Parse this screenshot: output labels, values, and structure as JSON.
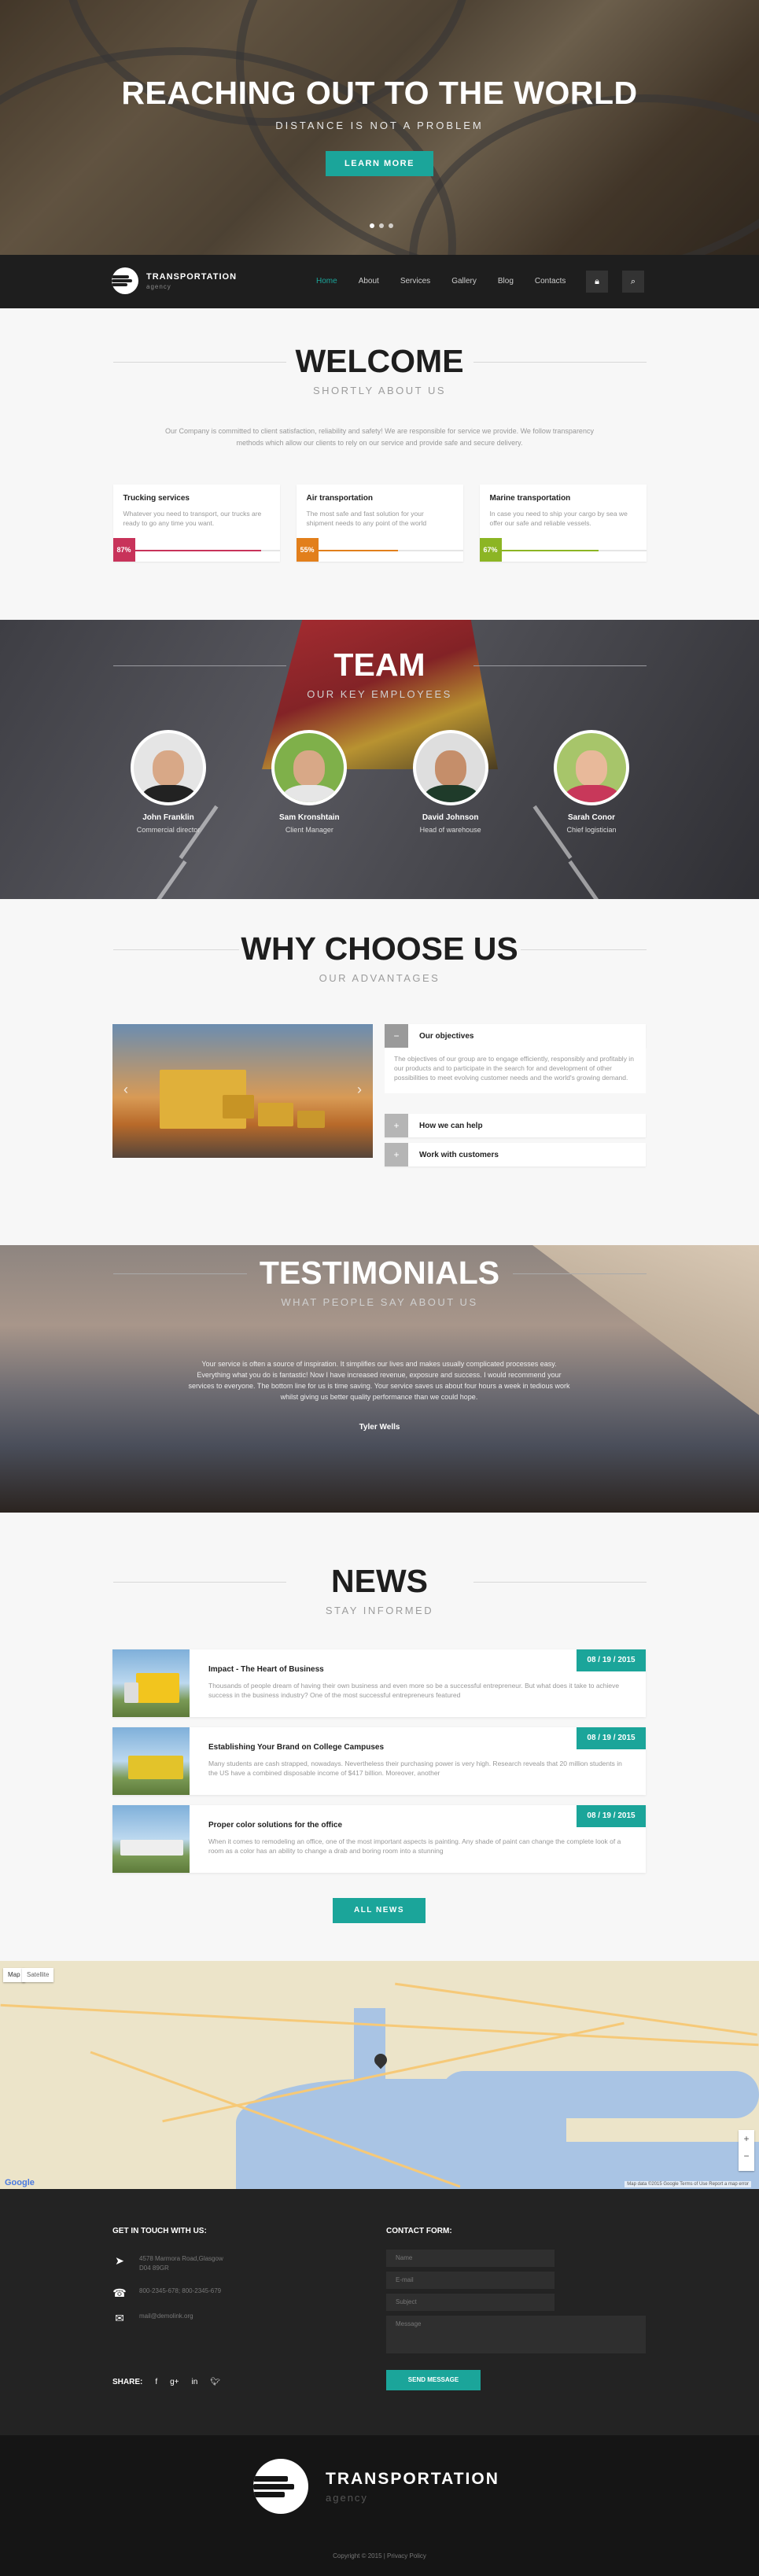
{
  "hero": {
    "title": "REACHING OUT TO THE WORLD",
    "subtitle": "DISTANCE IS NOT A PROBLEM",
    "button": "LEARN MORE"
  },
  "nav": {
    "logo_title": "TRANSPORTATION",
    "logo_sub": "agency",
    "items": [
      "Home",
      "About",
      "Services",
      "Gallery",
      "Blog",
      "Contacts"
    ],
    "active": "Home",
    "lock_icon": "lock-icon",
    "search_icon": "search-icon"
  },
  "welcome": {
    "title": "WELCOME",
    "subtitle": "SHORTLY ABOUT US",
    "intro": "Our Company is committed to client satisfaction, reliability and safety! We are responsible for service we provide. We follow transparency methods which allow our clients to rely on our service and provide safe and secure delivery.",
    "cards": [
      {
        "title": "Trucking services",
        "text": "Whatever you need to transport, our trucks are ready to go any time you want.",
        "percent": "87%",
        "value": 0.87,
        "color": "#c8335a"
      },
      {
        "title": "Air transportation",
        "text": "The most safe and fast solution for your shipment needs to any point of the world",
        "percent": "55%",
        "value": 0.55,
        "color": "#e27f1b"
      },
      {
        "title": "Marine transportation",
        "text": "In case you need to ship your cargo by sea we offer our safe and reliable vessels.",
        "percent": "67%",
        "value": 0.67,
        "color": "#8cb524"
      }
    ]
  },
  "team": {
    "title": "TEAM",
    "subtitle": "OUR KEY EMPLOYEES",
    "members": [
      {
        "name": "John Franklin",
        "role": "Commercial director"
      },
      {
        "name": "Sam Kronshtain",
        "role": "Client Manager"
      },
      {
        "name": "David Johnson",
        "role": "Head of warehouse"
      },
      {
        "name": "Sarah Conor",
        "role": "Chief logistician"
      }
    ]
  },
  "why": {
    "title": "WHY CHOOSE US",
    "subtitle": "OUR ADVANTAGES",
    "items": [
      {
        "title": "Our objectives",
        "text": "The objectives of our group are to engage efficiently, responsibly and profitably in our products and to participate in the search for and development of other possibilities to meet evolving customer needs and the world's growing demand."
      },
      {
        "title": "How we can help"
      },
      {
        "title": "Work with customers"
      }
    ]
  },
  "testimonials": {
    "title": "TESTIMONIALS",
    "subtitle": "WHAT PEOPLE SAY ABOUT US",
    "quote": "Your service is often a source of inspiration. It simplifies our lives and makes usually complicated processes easy. Everything what you do is fantastic! Now I have increased revenue, exposure and success. I would recommend your services to everyone. The bottom line for us is time saving. Your service saves us about four hours a week in tedious work whilst giving us better quality performance than we could hope.",
    "author": "Tyler Wells"
  },
  "news": {
    "title": "NEWS",
    "subtitle": "STAY INFORMED",
    "items": [
      {
        "date": "08 / 19 / 2015",
        "title": "Impact - The Heart of Business",
        "text": "Thousands of people dream of having their own business and even more so be a successful entrepreneur. But what does it take to achieve success in the business industry? One of the most successful entrepreneurs featured"
      },
      {
        "date": "08 / 19 / 2015",
        "title": "Establishing Your Brand on College Campuses",
        "text": "Many students are cash strapped, nowadays. Nevertheless their purchasing power is very high. Research reveals that 20 million students in the US have a combined disposable income of $417 billion. Moreover, another"
      },
      {
        "date": "08 / 19 / 2015",
        "title": "Proper color solutions for the office",
        "text": "When it comes to remodeling an office, one of the most important aspects is painting. Any shade of paint can change the complete look of a room as a color has an ability to change a drab and boring room into a stunning"
      }
    ],
    "button": "ALL NEWS"
  },
  "map": {
    "tab_map": "Map",
    "tab_sat": "Satellite",
    "google": "Google",
    "copyright": "Map data ©2015 Google  Terms of Use  Report a map error",
    "zoom_in": "+",
    "zoom_out": "−"
  },
  "contact": {
    "heading": "GET IN TOUCH WITH US:",
    "address": "4578 Marmora Road,Glasgow D04 89GR",
    "phone": "800-2345-678; 800-2345-679",
    "email": "mail@demolink.org",
    "share": "SHARE:",
    "form_heading": "CONTACT FORM:",
    "fields": [
      "Name",
      "E-mail",
      "Subject",
      "Message"
    ],
    "send": "SEND MESSAGE"
  },
  "footer": {
    "logo_title": "TRANSPORTATION",
    "logo_sub": "agency",
    "copyright": "Copyright © 2015 | Privacy Policy"
  }
}
